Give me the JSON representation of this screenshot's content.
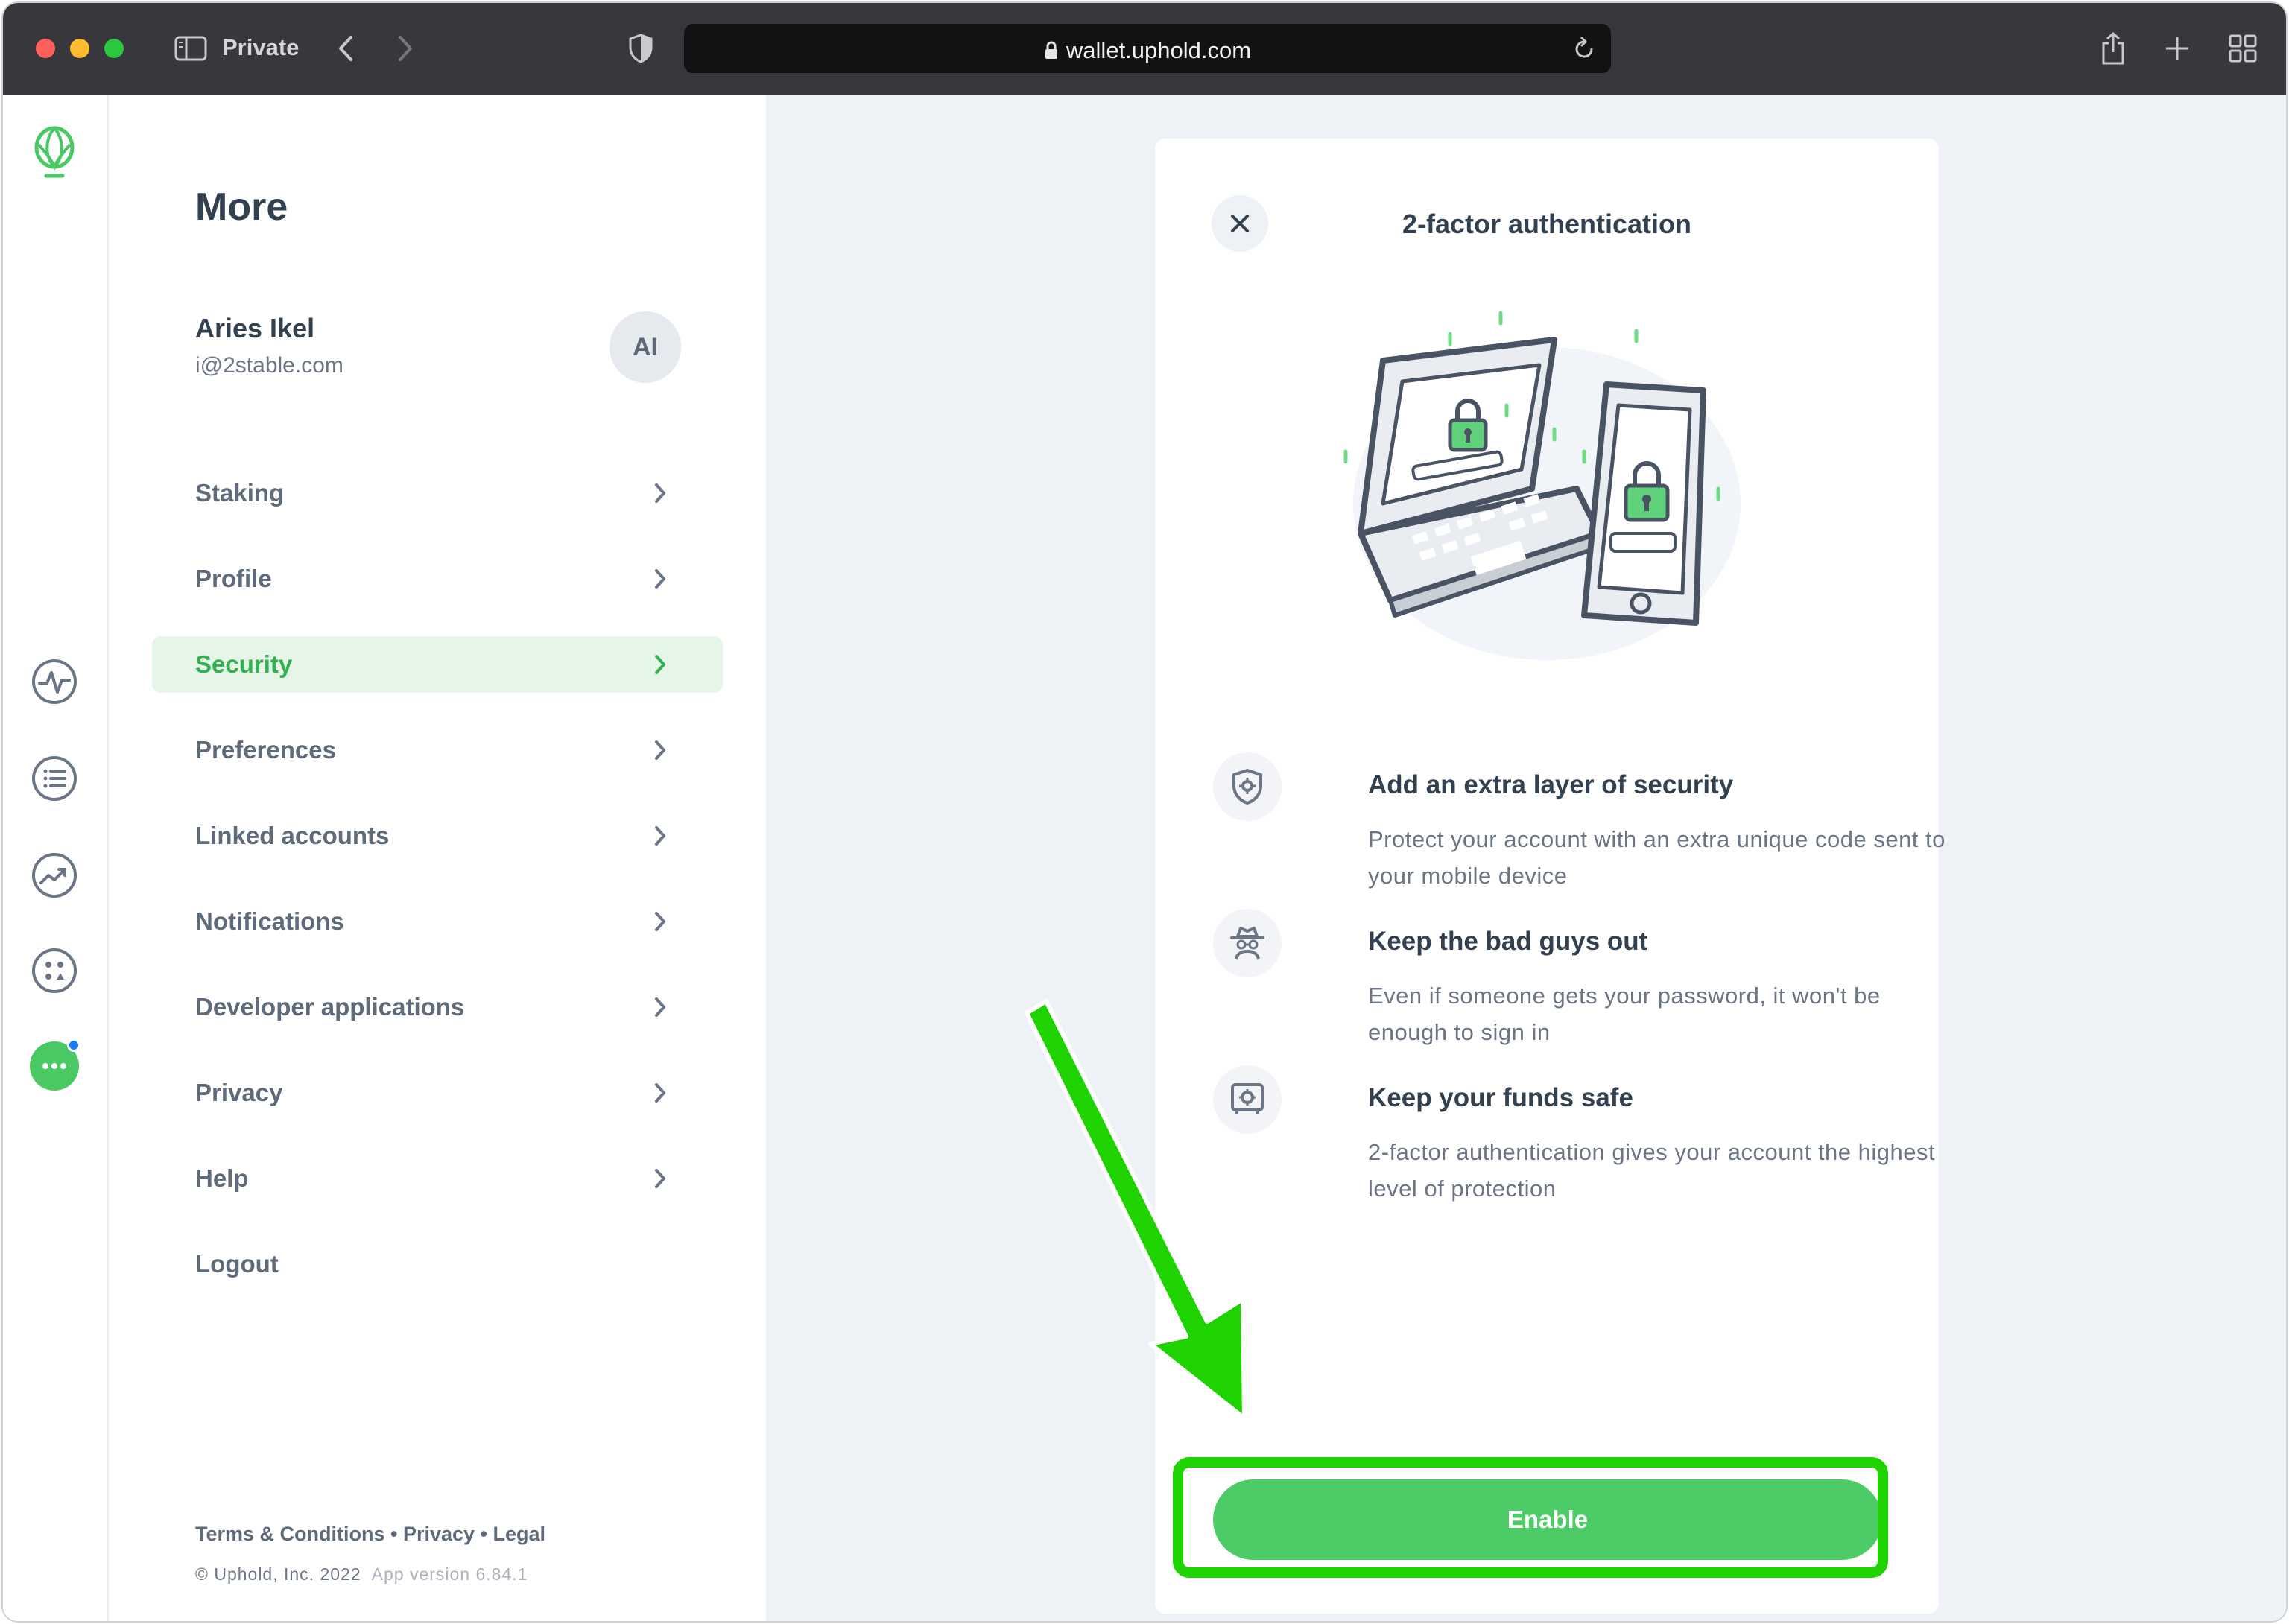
{
  "browser": {
    "mode_label": "Private",
    "url": "wallet.uphold.com"
  },
  "menu": {
    "title": "More",
    "user": {
      "name": "Aries Ikel",
      "email": "i@2stable.com",
      "initials": "AI"
    },
    "items": [
      {
        "label": "Staking",
        "active": false,
        "chevron": true
      },
      {
        "label": "Profile",
        "active": false,
        "chevron": true
      },
      {
        "label": "Security",
        "active": true,
        "chevron": true
      },
      {
        "label": "Preferences",
        "active": false,
        "chevron": true
      },
      {
        "label": "Linked accounts",
        "active": false,
        "chevron": true
      },
      {
        "label": "Notifications",
        "active": false,
        "chevron": true
      },
      {
        "label": "Developer applications",
        "active": false,
        "chevron": true
      },
      {
        "label": "Privacy",
        "active": false,
        "chevron": true
      },
      {
        "label": "Help",
        "active": false,
        "chevron": true
      },
      {
        "label": "Logout",
        "active": false,
        "chevron": false
      }
    ],
    "footer": {
      "links": "Terms & Conditions • Privacy • Legal",
      "copyright": "© Uphold, Inc. 2022",
      "version": "App version 6.84.1"
    }
  },
  "modal": {
    "title": "2-factor authentication",
    "features": [
      {
        "icon": "shield-gear-icon",
        "title": "Add an extra layer of security",
        "description": "Protect your account with an extra unique code sent to your mobile device"
      },
      {
        "icon": "spy-icon",
        "title": "Keep the bad guys out",
        "description": "Even if someone gets your password, it won't be enough to sign in"
      },
      {
        "icon": "safe-icon",
        "title": "Keep your funds safe",
        "description": "2-factor authentication gives your account the highest level of protection"
      }
    ],
    "enable_label": "Enable"
  },
  "colors": {
    "brand_green": "#4ccb66",
    "active_text": "#32b150",
    "annotation": "#1fd300"
  }
}
